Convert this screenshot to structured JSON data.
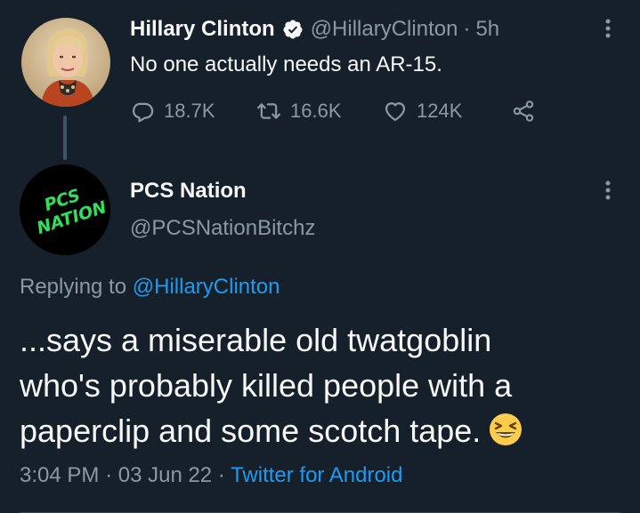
{
  "original_tweet": {
    "author_name": "Hillary Clinton",
    "handle": "@HillaryClinton",
    "separator": "·",
    "time_ago": "5h",
    "text": "No one actually needs an AR-15.",
    "stats": {
      "replies": "18.7K",
      "retweets": "16.6K",
      "likes": "124K"
    }
  },
  "reply_tweet": {
    "author_name": "PCS Nation",
    "handle": "@PCSNationBitchz",
    "avatar_text": [
      "PCS",
      "NATION"
    ],
    "replying_prefix": "Replying to",
    "replying_handle": "@HillaryClinton",
    "body_lines": [
      "...says a miserable old twatgoblin",
      "who's probably killed people with a",
      "paperclip and some scotch tape."
    ],
    "time": "3:04 PM",
    "date": "03 Jun 22",
    "separator": "·",
    "source": "Twitter for Android"
  },
  "colors": {
    "background": "#15202b",
    "primary_text": "#f7f9f9",
    "secondary_text": "#8b98a5",
    "accent": "#1d9bf0",
    "avatar_logo_green": "#2ee05a"
  },
  "icons": {
    "verified": "verified-badge-icon",
    "more": "more-dots-icon",
    "reply": "reply-bubble-icon",
    "retweet": "retweet-icon",
    "like": "heart-icon",
    "share": "share-icon",
    "emoji": "grinning-squinting-face-emoji"
  }
}
